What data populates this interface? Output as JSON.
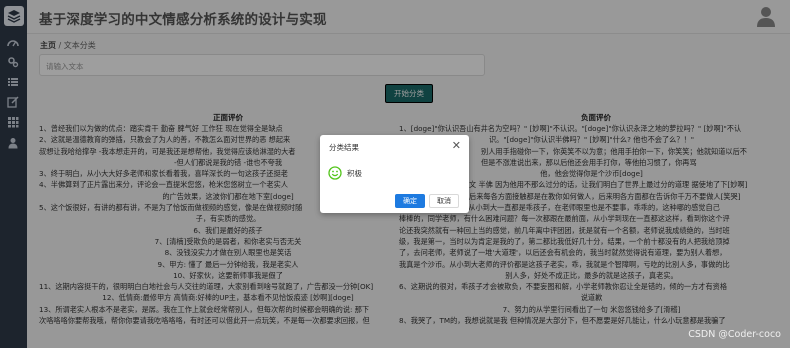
{
  "header": {
    "title": "基于深度学习的中文情感分析系统的设计与实现",
    "avatar_icon": "user-avatar-icon"
  },
  "sidebar": {
    "icons": [
      "layers-logo-icon",
      "dashboard-icon",
      "cogs-icon",
      "list-icon",
      "edit-icon",
      "table-icon",
      "user-icon"
    ]
  },
  "breadcrumb": {
    "home": "主页",
    "separator": "/",
    "current": "文本分类"
  },
  "input": {
    "placeholder": "请输入文本"
  },
  "start_button": "开始分类",
  "positive": {
    "title": "正面评价",
    "lines": [
      "1、曾经我们以为做的优点：踏实肯干 勤奋 脾气好 工作狂 现在觉得全是缺点",
      "2、这就是温德教育的弹插，只教会了为人的善，不教怎么面对世界的恶 想起来",
      "叔想让我哈给撑孕 -我本想走开的，可是我还是想帮他，我觉得应该给淋湿的大者",
      "-但人们都说是我的错 -谁也不夸我",
      "3、终于明白，从小大大好多老师和家长看着我，喜咩深长的一句这孩子还挺老",
      "4、半佛算到了正片露出来分，评论会一直提米您悠，枪米您悠树立一个老实人",
      "的广告效果，这波你们都在地下室[doge]",
      "5、这个饭很好，有讲的都有讲，不是为了恰饭而做视频的感觉，像是在做视频时随",
      "子，有实质的感觉。",
      "6、我们是最好的孩子",
      "7、[清楠]受欺负的是弱者，和你老实与否无关",
      "8、没钱没实力才做在别人眼里也是笑话",
      "9、甲方: 懂了 最后一分钟给我，我是老实人",
      "10、好家伙，这要新师事我是假了",
      "11、这期内容挺干的，很明明白白地社会与人交往的道理，大家别看到啥号就跑了，广告都没一分钟[OK]",
      "12、低情商:最修甲方  高情商:好棒的UP主，基本看不见恰饭痕迹 [妙啊][doge]",
      "13、所谓老实人根本不是老实，是孱。我在工作上就会经常帮别人，但每次帮的时候都会明确的说: 那下",
      "次咯咯咯你要帮我哦，帮你你要请我吃咯咯咯，有时还可以借此开一点玩笑，不是每一次都要求回报，但"
    ]
  },
  "negative": {
    "title": "负面评价",
    "lines": [
      "1、[doge]\"你认识吾山有井名为空吗？\" [妙啊]\"不认识。\"[doge]\"你认识永泽之地的萝拉吗？\" [妙啊]\"不认",
      "识。\"[doge]\"你认识半佛吗？\" [妙啊]\"什么? 他也不会了么？！\"",
      "别人用手指碰你一下，你英笑不以为意；他用手拍你一下，你笑笑；他就知道以后不",
      "但是不涨准说出来，那以后他还会用手打你，等他拍习惯了，你再骂",
      "他，他会觉得你是个沙币[doge]",
      "文 半佛 因为他用不那么过分的话，让我们明白了世界上最过分的道理 据使地了下[妙啊]",
      "后来每各方面接触都是在教你如何做人，后来明各方面都在告诉你千万不要做人[笑哭]",
      "4、我待会要笑了，我从小到大一直都是乖孩子，在老师眼里也是不要事，乖乖的，这种哪的感觉自己",
      "棒棒的，同学老师，有什么困难问题？每一次都跟在最前面，从小学到现在一直都这这样，看到你这个评",
      "论还我突然就有一种回上当的感觉，前几年离中评团团，抚是就有一个名额，老师说我成绩绝的，当时班",
      "级，我是第一，当时以为肯定是我的了，第二都比我低好几十分，结果，一个前十都没有的人把我给顶掉",
      "了，去问老师，老师说了一堆'大道理'，以后还会有机会的，我当时就然觉得说有道理，要为别人着想，",
      "我真是个沙币。从小到大老师的评价都是这孩子老实，乖，我就是个智障啊，亏吃的比别人多，事做的比",
      "别人多，好处不成正比，最多的就是这孩子，真老实。",
      "6、这期说的很对，乖孩子才会被欺负，不要妄图和解，小学老师教你忍让全是错的，倾的一方才有资格",
      "说道歉",
      "7、努力的从学里行间看出了一句 米忽悠钱给多了[滑稽]",
      "8、我哭了，TM的，我想说就是我 但种情况是大部分下，但不愿要是好几能让，什么小玩意都是我骗了"
    ]
  },
  "modal": {
    "title": "分类结果",
    "close_icon": "close-icon",
    "result_icon": "smile-icon",
    "result_text": "积极",
    "ok_label": "确定",
    "cancel_label": "取消"
  },
  "watermark": "CSDN @Coder-coco"
}
